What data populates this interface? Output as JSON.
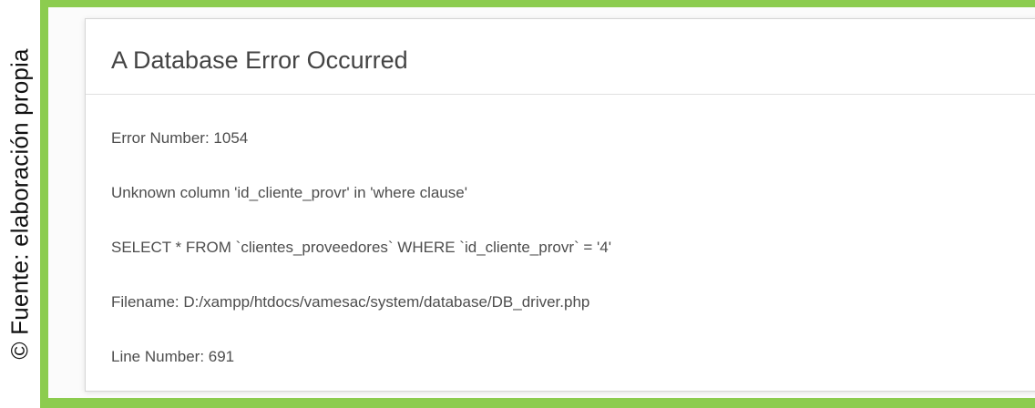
{
  "credit": "© Fuente: elaboración propia",
  "colors": {
    "frame_border": "#8ccc4f",
    "panel_background": "#ffffff",
    "title_text": "#444444",
    "body_text": "#4d4d4d"
  },
  "error": {
    "title": "A Database Error Occurred",
    "lines": [
      "Error Number: 1054",
      "Unknown column 'id_cliente_provr' in 'where clause'",
      "SELECT * FROM `clientes_proveedores` WHERE `id_cliente_provr` = '4'",
      "Filename: D:/xampp/htdocs/vamesac/system/database/DB_driver.php",
      "Line Number: 691"
    ]
  }
}
